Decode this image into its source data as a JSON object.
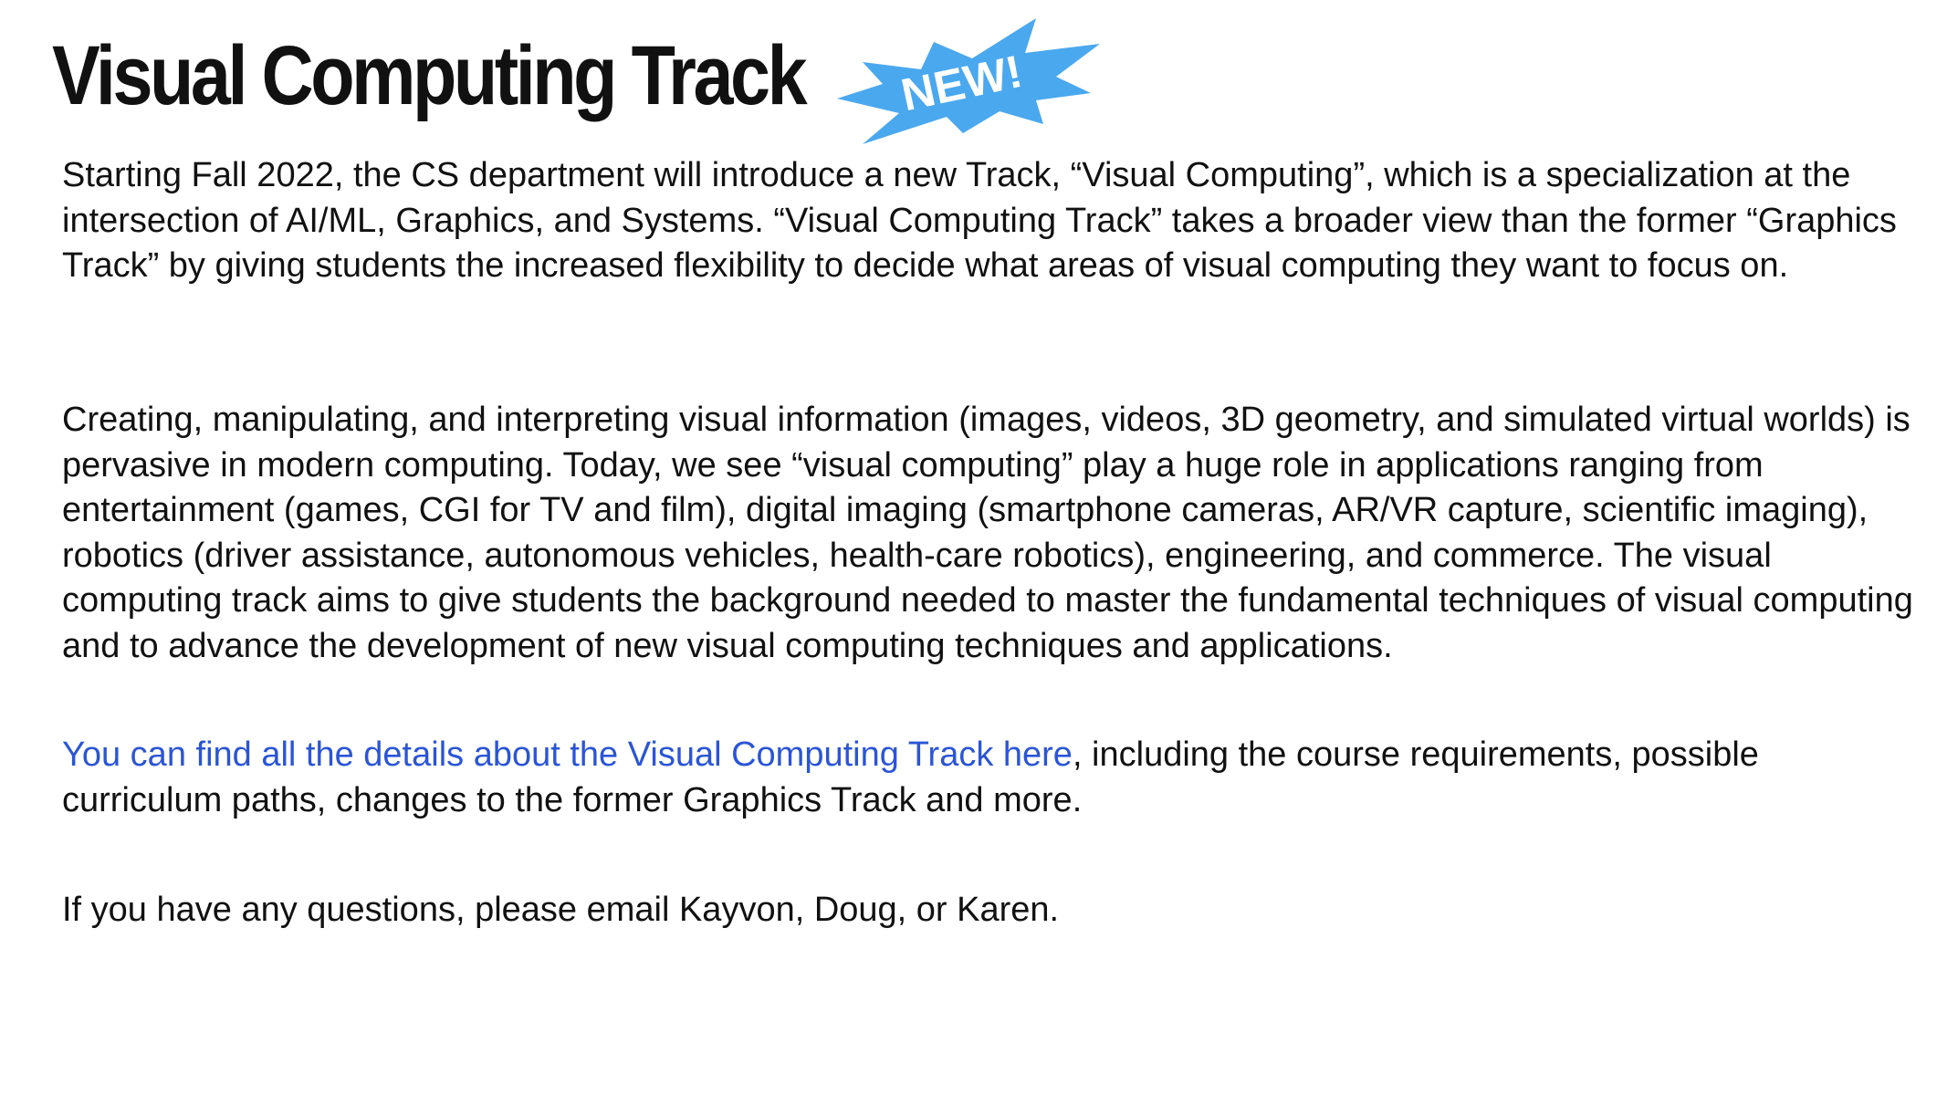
{
  "slide": {
    "title": "Visual Computing Track",
    "badge_text": "NEW!",
    "badge_color": "#4aa8ee",
    "link_color": "#2b55d6",
    "paragraphs": {
      "p1": "Starting Fall 2022, the CS department will introduce a new Track, “Visual Computing”, which is a specialization at the intersection of AI/ML, Graphics, and Systems. “Visual Computing Track” takes a broader view than the former “Graphics Track” by giving students the increased flexibility to decide what areas of visual computing they want to focus on.",
      "p2": "Creating, manipulating, and interpreting visual information (images, videos, 3D geometry, and simulated virtual worlds) is pervasive in modern computing. Today, we see “visual computing” play a huge role in applications ranging from entertainment (games, CGI for TV and film), digital imaging (smartphone cameras, AR/VR capture, scientific imaging), robotics (driver assistance, autonomous vehicles, health-care robotics), engineering, and commerce.  The visual computing track aims to give students the background needed to master the fundamental techniques of visual computing and to advance the development of new visual computing techniques and applications.",
      "p3_link": "You can find all the details about the Visual Computing Track here",
      "p3_rest": ", including the course requirements, possible curriculum paths, changes to the former Graphics Track and more.",
      "p4": "If you have any questions, please email Kayvon, Doug, or Karen."
    }
  }
}
